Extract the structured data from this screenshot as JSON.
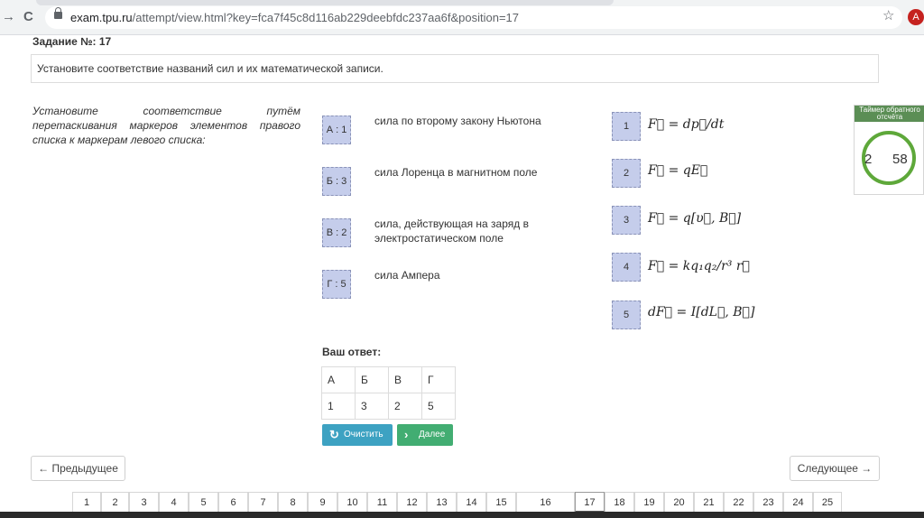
{
  "browser": {
    "url_host": "exam.tpu.ru",
    "url_path": "/attempt/view.html?key=fca7f45c8d116ab229deebfdc237aa6f&position=17",
    "avatar_letter": "A",
    "back_glyph": "→",
    "reload_glyph": "C",
    "star_glyph": "☆"
  },
  "question": {
    "label": "Задание №:",
    "number": "17",
    "text": "Установите соответствие названий сил и их математической записи.",
    "instructions": "Установите соответствие путём перетаскивания маркеров элементов правого списка к маркерам левого списка:"
  },
  "left_items": [
    {
      "marker": "А : 1",
      "text": "сила по второму закону Ньютона"
    },
    {
      "marker": "Б : 3",
      "text": "сила Лоренца в магнитном поле"
    },
    {
      "marker": "В : 2",
      "text": "сила, действующая на заряд в электростатическом поле"
    },
    {
      "marker": "Г : 5",
      "text": "сила Ампера"
    }
  ],
  "right_items": [
    {
      "marker": "1",
      "formula": "F⃗ = dp⃗/dt"
    },
    {
      "marker": "2",
      "formula": "F⃗ = qE⃗"
    },
    {
      "marker": "3",
      "formula": "F⃗ = q[υ⃗, B⃗]"
    },
    {
      "marker": "4",
      "formula": "F⃗ = kq₁q₂/r³ r⃗"
    },
    {
      "marker": "5",
      "formula": "dF⃗ = I[dL⃗, B⃗]"
    }
  ],
  "timer": {
    "title": "Таймер обратного отсчёта",
    "minutes": "2",
    "seconds": "58",
    "color": "#5ea83a"
  },
  "answer": {
    "label": "Ваш ответ:",
    "headers": [
      "А",
      "Б",
      "В",
      "Г"
    ],
    "values": [
      "1",
      "3",
      "2",
      "5"
    ]
  },
  "buttons": {
    "clear": "Очистить",
    "next": "Далее",
    "prev_page": "← Предыдущее",
    "next_page": "Следующее →"
  },
  "pagination": {
    "pages": [
      "1",
      "2",
      "3",
      "4",
      "5",
      "6",
      "7",
      "8",
      "9",
      "10",
      "11",
      "12",
      "13",
      "14",
      "15",
      "16",
      "17",
      "18",
      "19",
      "20",
      "21",
      "22",
      "23",
      "24",
      "25"
    ],
    "current": "17"
  }
}
